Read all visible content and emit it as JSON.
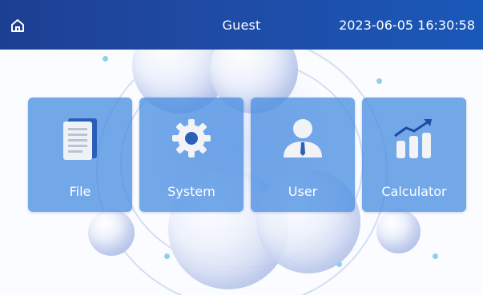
{
  "header": {
    "user": "Guest",
    "datetime": "2023-06-05 16:30:58",
    "home_icon": "home-icon"
  },
  "tiles": [
    {
      "label": "File",
      "icon": "file-icon"
    },
    {
      "label": "System",
      "icon": "gear-icon"
    },
    {
      "label": "User",
      "icon": "user-icon"
    },
    {
      "label": "Calculator",
      "icon": "chart-icon"
    }
  ],
  "colors": {
    "header_bg": "#1f4aa3",
    "tile_bg": "#4c8fe2",
    "text": "#ffffff"
  }
}
